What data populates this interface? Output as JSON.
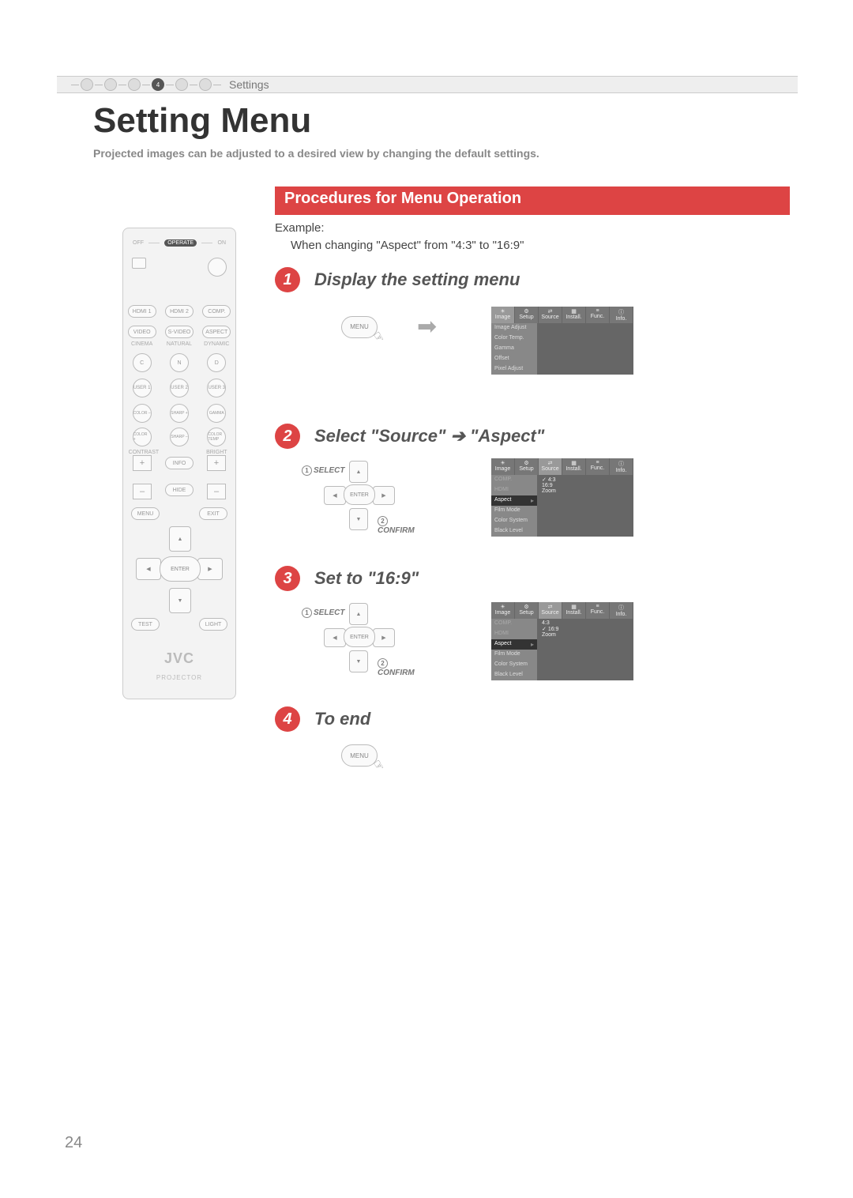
{
  "top": {
    "section": "Settings",
    "active_dot": "4"
  },
  "title": "Setting Menu",
  "subtitle": "Projected images can be adjusted to a desired view by changing the default settings.",
  "procedures_header": "Procedures for Menu Operation",
  "example": {
    "label": "Example:",
    "text": "When changing \"Aspect\" from \"4:3\" to \"16:9\""
  },
  "steps": [
    {
      "num": "1",
      "title": "Display the setting menu"
    },
    {
      "num": "2",
      "title": "Select \"Source\" ➔ \"Aspect\""
    },
    {
      "num": "3",
      "title": "Set to \"16:9\""
    },
    {
      "num": "4",
      "title": "To end"
    }
  ],
  "labels": {
    "select": "SELECT",
    "confirm": "CONFIRM"
  },
  "remote": {
    "off": "OFF",
    "on": "ON",
    "operate": "OPERATE",
    "row1": [
      "HDMI 1",
      "HDMI 2",
      "COMP."
    ],
    "row2": [
      "VIDEO",
      "S-VIDEO",
      "ASPECT"
    ],
    "row3labels": [
      "CINEMA",
      "NATURAL",
      "DYNAMIC"
    ],
    "row3": [
      "C",
      "N",
      "D"
    ],
    "row4": [
      "USER 1",
      "USER 2",
      "USER 3"
    ],
    "row5": [
      "COLOR –",
      "SHARP +",
      "GAMMA"
    ],
    "row6": [
      "COLOR +",
      "SHARP –",
      "COLOR TEMP"
    ],
    "contrast": "CONTRAST",
    "bright": "BRIGHT",
    "info": "INFO",
    "hide": "HIDE",
    "menu": "MENU",
    "exit": "EXIT",
    "enter": "ENTER",
    "test": "TEST",
    "light": "LIGHT",
    "brand": "JVC",
    "brandsub": "PROJECTOR"
  },
  "osd": {
    "tabs": [
      "Image",
      "Setup",
      "Source",
      "Install.",
      "Func.",
      "Info."
    ],
    "image_items": [
      "Image Adjust",
      "Color Temp.",
      "Gamma",
      "Offset",
      "Pixel Adjust"
    ],
    "source_items": [
      "COMP.",
      "HDMI",
      "Aspect",
      "Film Mode",
      "Color System",
      "Black Level"
    ],
    "aspect_options": [
      "4:3",
      "16:9",
      "Zoom"
    ]
  },
  "page_number": "24"
}
